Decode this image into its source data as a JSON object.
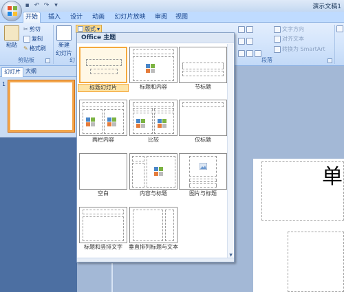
{
  "window": {
    "title": "演示文稿1"
  },
  "tabs": [
    "开始",
    "插入",
    "设计",
    "动画",
    "幻灯片放映",
    "审阅",
    "视图"
  ],
  "ribbon": {
    "clipboard": {
      "paste": "粘贴",
      "cut": "剪切",
      "copy": "复制",
      "format_painter": "格式刷",
      "label": "剪贴板"
    },
    "slides": {
      "new_slide_line1": "新建",
      "new_slide_line2": "幻灯片",
      "layout_button": "版式",
      "label": "幻"
    },
    "paragraph": {
      "text_direction": "文字方向",
      "align_text": "对齐文本",
      "smartart": "转换为 SmartArt",
      "label": "段落"
    }
  },
  "left_panel": {
    "tab_slides": "幻灯片",
    "tab_outline": "大纲",
    "slide_number": "1"
  },
  "dropdown": {
    "header": "Office 主题",
    "layouts": [
      {
        "name": "标题幻灯片",
        "selected": true
      },
      {
        "name": "标题和内容",
        "selected": false
      },
      {
        "name": "节标题",
        "selected": false
      },
      {
        "name": "两栏内容",
        "selected": false
      },
      {
        "name": "比较",
        "selected": false
      },
      {
        "name": "仅标题",
        "selected": false
      },
      {
        "name": "空白",
        "selected": false
      },
      {
        "name": "内容与标题",
        "selected": false
      },
      {
        "name": "图片与标题",
        "selected": false
      },
      {
        "name": "标题和竖排文字",
        "selected": false
      },
      {
        "name": "垂直排列标题与文本",
        "selected": false
      }
    ]
  },
  "slide": {
    "visible_text": "单"
  }
}
